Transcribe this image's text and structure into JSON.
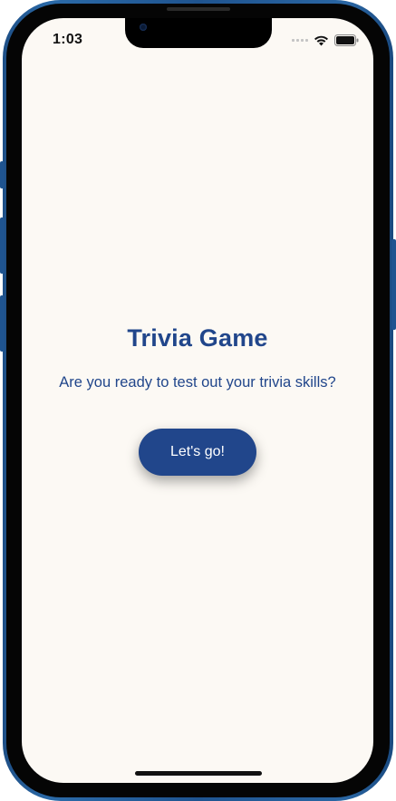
{
  "status_bar": {
    "time": "1:03",
    "icons": [
      "signal-icon",
      "wifi-icon",
      "battery-icon"
    ]
  },
  "main": {
    "title": "Trivia Game",
    "subtitle": "Are you ready to test out your trivia skills?",
    "start_button_label": "Let's go!"
  },
  "colors": {
    "primary": "#21468b",
    "background": "#fcf9f4",
    "frame": "#1f5490"
  }
}
